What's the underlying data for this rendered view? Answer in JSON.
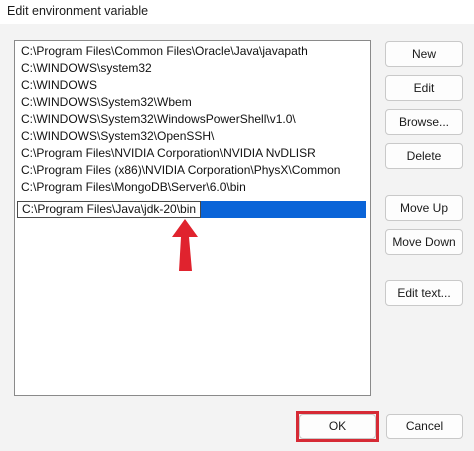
{
  "window": {
    "title": "Edit environment variable"
  },
  "list": {
    "items": [
      "C:\\Program Files\\Common Files\\Oracle\\Java\\javapath",
      "C:\\WINDOWS\\system32",
      "C:\\WINDOWS",
      "C:\\WINDOWS\\System32\\Wbem",
      "C:\\WINDOWS\\System32\\WindowsPowerShell\\v1.0\\",
      "C:\\WINDOWS\\System32\\OpenSSH\\",
      "C:\\Program Files\\NVIDIA Corporation\\NVIDIA NvDLISR",
      "C:\\Program Files (x86)\\NVIDIA Corporation\\PhysX\\Common",
      "C:\\Program Files\\MongoDB\\Server\\6.0\\bin"
    ],
    "editing_value": "C:\\Program Files\\Java\\jdk-20\\bin"
  },
  "buttons": {
    "new": "New",
    "edit": "Edit",
    "browse": "Browse...",
    "delete": "Delete",
    "move_up": "Move Up",
    "move_down": "Move Down",
    "edit_text": "Edit text...",
    "ok": "OK",
    "cancel": "Cancel"
  },
  "annotations": {
    "arrow_color": "#e0232e",
    "highlight_color": "#d62a35",
    "selection_color": "#0a64d8",
    "arrow_icon": "up-arrow-icon"
  }
}
